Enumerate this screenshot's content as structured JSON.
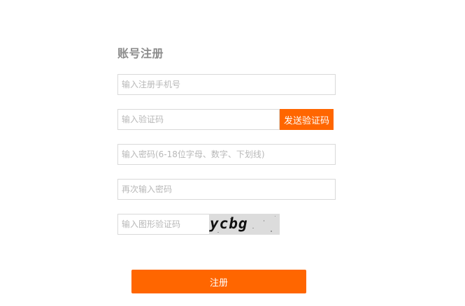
{
  "form": {
    "title": "账号注册",
    "phone": {
      "placeholder": "输入注册手机号",
      "value": ""
    },
    "sms_code": {
      "placeholder": "输入验证码",
      "value": ""
    },
    "send_code_label": "发送验证码",
    "password": {
      "placeholder": "输入密码(6-18位字母、数字、下划线)",
      "value": ""
    },
    "confirm_password": {
      "placeholder": "再次输入密码",
      "value": ""
    },
    "image_code": {
      "placeholder": "输入图形验证码",
      "value": ""
    },
    "captcha_text": "ycbg",
    "submit_label": "注册"
  },
  "colors": {
    "accent": "#ff6600",
    "captcha_bg": "#dcdcdc",
    "title": "#8c8c8c",
    "border": "#d9d9d9"
  }
}
